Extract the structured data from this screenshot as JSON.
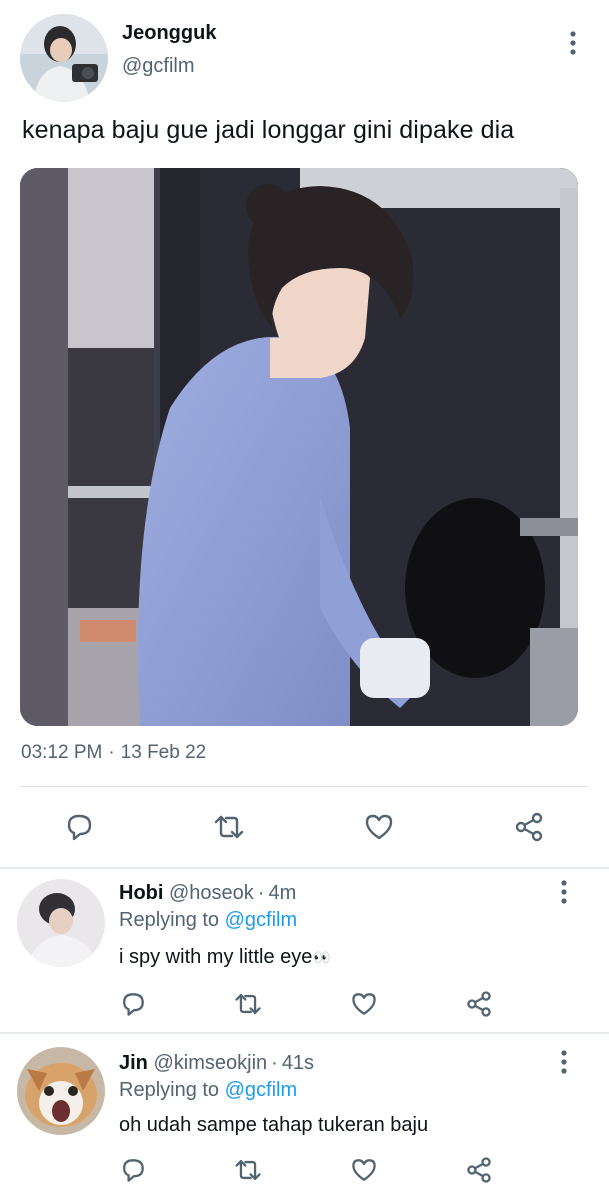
{
  "tweet": {
    "author_name": "Jeongguk",
    "author_handle": "@gcfilm",
    "text": "kenapa baju gue jadi longgar gini dipake dia",
    "time": "03:12 PM",
    "date": "13 Feb 22",
    "actions": [
      "reply-icon",
      "retweet-icon",
      "like-icon",
      "share-icon"
    ]
  },
  "replies": [
    {
      "name": "Hobi",
      "handle": "@hoseok",
      "time": "4m",
      "replying_label": "Replying to",
      "replying_to": "@gcfilm",
      "text": "i spy with my little eye",
      "emoji": "👀"
    },
    {
      "name": "Jin",
      "handle": "@kimseokjin",
      "time": "41s",
      "replying_label": "Replying to",
      "replying_to": "@gcfilm",
      "text": "oh udah sampe tahap tukeran baju"
    }
  ],
  "separator_dot": "·",
  "colors": {
    "text": "#0f1419",
    "secondary": "#536471",
    "link": "#1d9bf0",
    "divider": "#e6e9ec"
  }
}
